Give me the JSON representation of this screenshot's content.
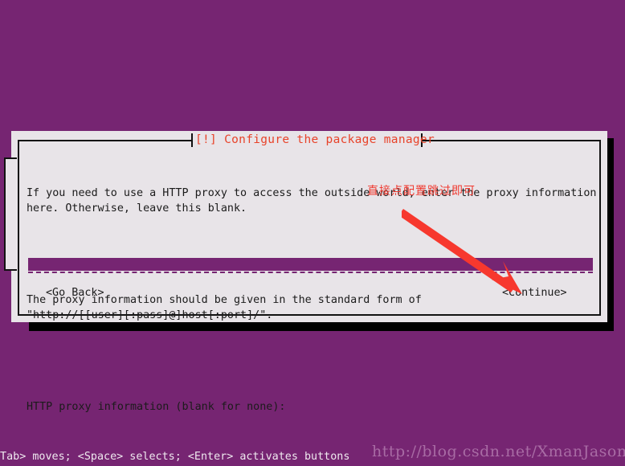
{
  "screen": {
    "background_color": "#762572",
    "dialog_bg_color": "#e8e4e8",
    "accent_red": "#e8432a",
    "annotation_red": "#f03a30",
    "field_color": "#762572",
    "shadow_color": "#000000"
  },
  "dialog": {
    "title": "[!] Configure the package manager",
    "paragraphs": [
      "If you need to use a HTTP proxy to access the outside world, enter the proxy information\nhere. Otherwise, leave this blank.",
      "The proxy information should be given in the standard form of\n\"http://[[user][:pass]@]host[:port]/\".",
      "HTTP proxy information (blank for none):"
    ],
    "input": {
      "label": "HTTP proxy information (blank for none):",
      "value": "",
      "placeholder": ""
    },
    "buttons": {
      "go_back": "<Go Back>",
      "continue": "<Continue>"
    }
  },
  "annotation": {
    "text": "直接点配置跳过即可",
    "arrow": "red-arrow-pointing-to-continue"
  },
  "status_bar": {
    "text": "<Tab> moves; <Space> selects; <Enter> activates buttons"
  },
  "watermark": {
    "text": "http://blog.csdn.net/XmanJason"
  }
}
